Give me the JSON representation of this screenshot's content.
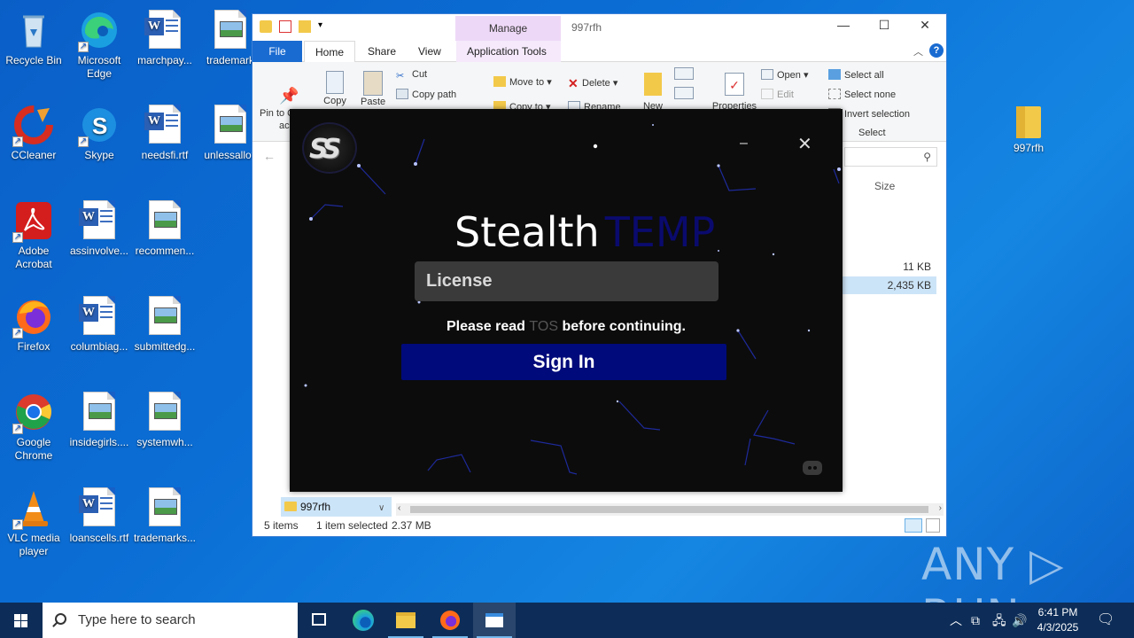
{
  "desktop": {
    "icons": [
      {
        "label": "Recycle Bin"
      },
      {
        "label": "Microsoft Edge"
      },
      {
        "label": "marchpay..."
      },
      {
        "label": "trademark"
      },
      {
        "label": "CCleaner"
      },
      {
        "label": "Skype"
      },
      {
        "label": "needsfi.rtf"
      },
      {
        "label": "unlessallov"
      },
      {
        "label": "Adobe Acrobat"
      },
      {
        "label": "assinvolve..."
      },
      {
        "label": "recommen..."
      },
      {
        "label": "Firefox"
      },
      {
        "label": "columbiag..."
      },
      {
        "label": "submittedg..."
      },
      {
        "label": "Google Chrome"
      },
      {
        "label": "insidegirls...."
      },
      {
        "label": "systemwh..."
      },
      {
        "label": "VLC media player"
      },
      {
        "label": "loanscells.rtf"
      },
      {
        "label": "trademarks..."
      },
      {
        "label": "997rfh"
      }
    ]
  },
  "explorer": {
    "title": "997rfh",
    "manage_tab": "Manage",
    "tabs": [
      "File",
      "Home",
      "Share",
      "View",
      "Application Tools"
    ],
    "ribbon": {
      "pin": "Pin to Quick",
      "pin2": "acce",
      "copy": "Copy",
      "paste": "Paste",
      "cut": "Cut",
      "copy_path": "Copy path",
      "move_to": "Move to",
      "copy_to": "Copy to",
      "delete": "Delete",
      "rename": "Rename",
      "new": "New",
      "properties": "Properties",
      "open": "Open",
      "edit": "Edit",
      "select_all": "Select all",
      "select_none": "Select none",
      "invert_selection": "Invert selection",
      "select_group": "Select"
    },
    "column_size": "Size",
    "sizes": [
      "11 KB",
      "2,435 KB"
    ],
    "nav_selected": "997rfh",
    "status": {
      "items": "5 items",
      "selected": "1 item selected",
      "size": "2.37 MB"
    }
  },
  "stealth": {
    "logo_text": "SS",
    "minimize": "–",
    "close": "✕",
    "brand_white": "Stealth",
    "brand_blue": "TEMP",
    "license_placeholder": "License",
    "tos_pre": "Please read",
    "tos_link": "TOS",
    "tos_post": "before continuing.",
    "sign_in": "Sign In"
  },
  "watermark": "ANY ▷ RUN",
  "taskbar": {
    "search_placeholder": "Type here to search",
    "time": "6:41 PM",
    "date": "4/3/2025"
  }
}
